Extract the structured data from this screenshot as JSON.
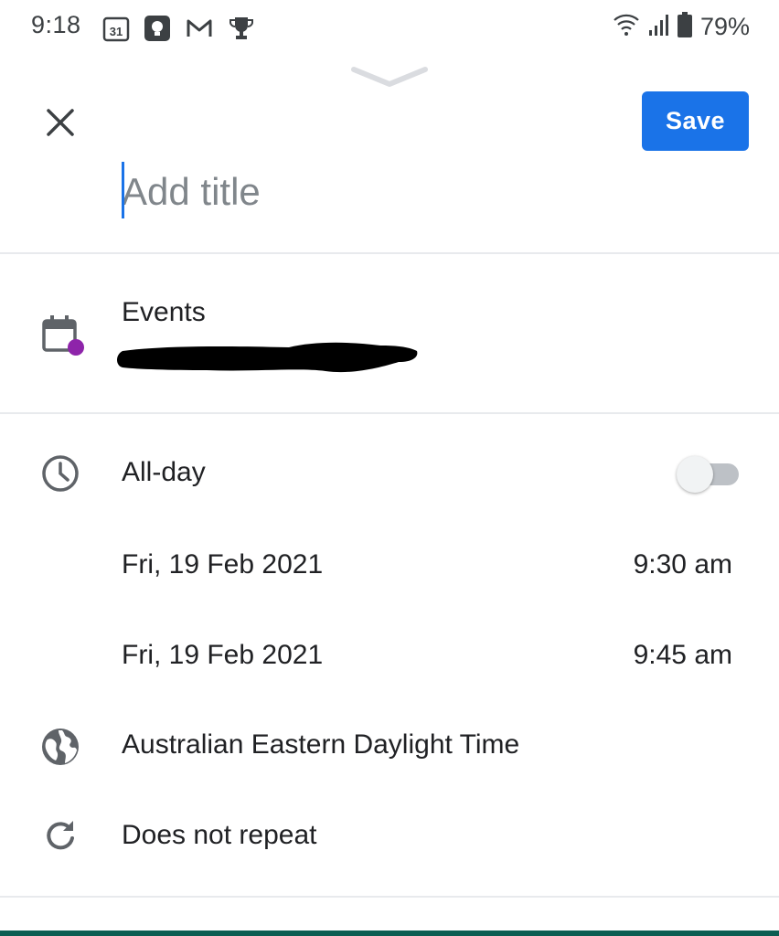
{
  "status_bar": {
    "time": "9:18",
    "notification_icons": [
      "calendar-31-icon",
      "keep-icon",
      "gmail-icon",
      "trophy-icon"
    ],
    "calendar_day": "31",
    "right_icons": [
      "wifi-icon",
      "signal-icon",
      "battery-icon"
    ],
    "battery": "79%"
  },
  "header": {
    "close_icon": "close-icon",
    "save_label": "Save",
    "title_placeholder": "Add title"
  },
  "calendar_section": {
    "calendar_name": "Events",
    "account_redacted": true,
    "calendar_color": "#8e24aa"
  },
  "time_section": {
    "all_day_label": "All-day",
    "all_day_enabled": false,
    "start": {
      "date": "Fri, 19 Feb 2021",
      "time": "9:30 am"
    },
    "end": {
      "date": "Fri, 19 Feb 2021",
      "time": "9:45 am"
    },
    "timezone": "Australian Eastern Daylight Time",
    "repeat": "Does not repeat"
  },
  "colors": {
    "accent": "#1a73e8",
    "calendar_purple": "#8e24aa",
    "icon_grey": "#5f6368"
  }
}
